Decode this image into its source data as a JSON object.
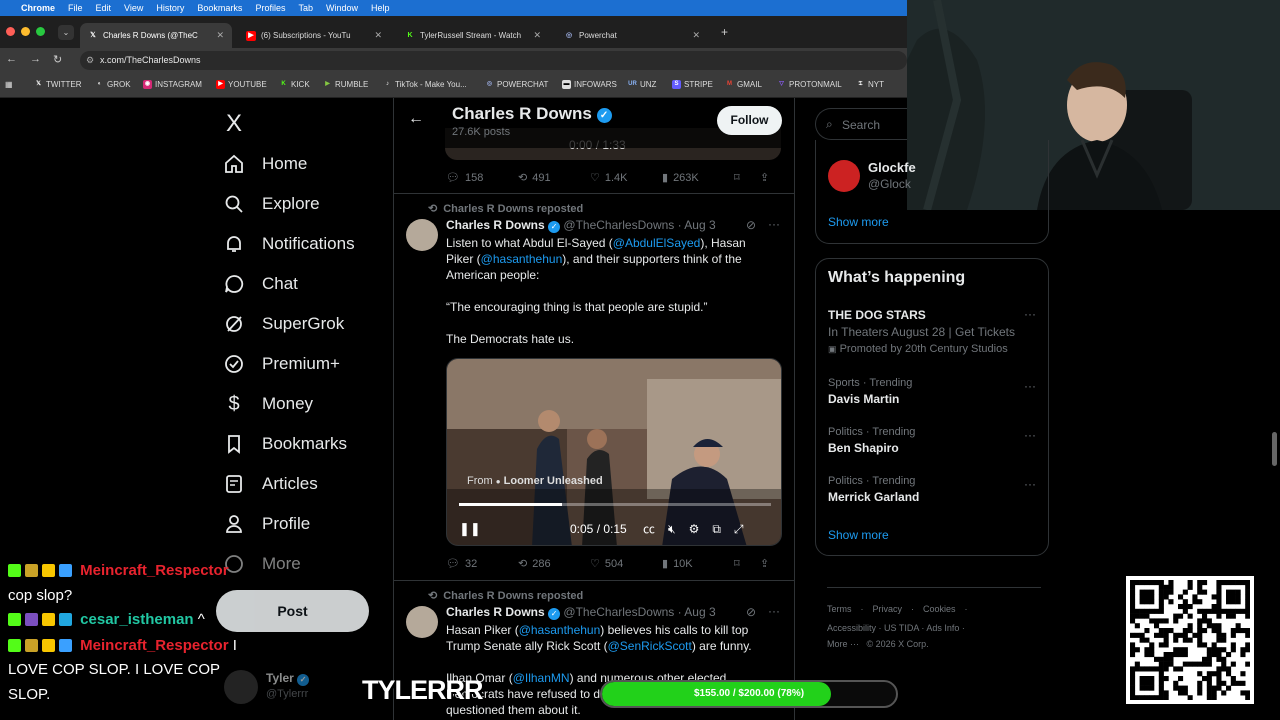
{
  "menubar": {
    "app": "Chrome",
    "items": [
      "File",
      "Edit",
      "View",
      "History",
      "Bookmarks",
      "Profiles",
      "Tab",
      "Window",
      "Help"
    ]
  },
  "tabs": [
    {
      "title": "Charles R Downs (@TheC",
      "active": true
    },
    {
      "title": "(6) Subscriptions - YouTu",
      "active": false
    },
    {
      "title": "TylerRussell Stream - Watch",
      "active": false
    },
    {
      "title": "Powerchat",
      "active": false
    }
  ],
  "url": "x.com/TheCharlesDowns",
  "bookmarks": [
    "TWITTER",
    "GROK",
    "INSTAGRAM",
    "YOUTUBE",
    "KICK",
    "RUMBLE",
    "TikTok - Make You...",
    "POWERCHAT",
    "INFOWARS",
    "UNZ",
    "STRIPE",
    "GMAIL",
    "PROTONMAIL",
    "NYT"
  ],
  "nav": {
    "logo": "X",
    "items": [
      "Home",
      "Explore",
      "Notifications",
      "Chat",
      "SuperGrok",
      "Premium+",
      "Money",
      "Bookmarks",
      "Articles",
      "Profile",
      "More"
    ],
    "post_button": "Post",
    "account_name": "Tyler",
    "account_handle": "@Tylerrr"
  },
  "profile_header": {
    "name": "Charles R Downs",
    "posts": "27.6K posts",
    "follow": "Follow"
  },
  "prev_video_time": "0:00 / 1:33",
  "prev_actions": {
    "replies": "158",
    "reposts": "491",
    "likes": "1.4K",
    "views": "263K"
  },
  "tweet1": {
    "repost_label": "Charles R Downs reposted",
    "name": "Charles R Downs",
    "handle": "@TheCharlesDowns · Aug 3",
    "t1": "Listen to what Abdul El-Sayed (",
    "l1": "@AbdulElSayed",
    "t2": "), Hasan",
    "t3": "Piker (",
    "l2": "@hasanthehun",
    "t4": "), and their supporters think of the",
    "t5": "American people:",
    "quote": "“The encouraging thing is that people are stupid.”",
    "closing": "The Democrats hate us.",
    "video": {
      "from": "From",
      "source": "Loomer Unleashed",
      "time": "0:05 / 0:15",
      "progress": 0.33
    },
    "actions": {
      "replies": "32",
      "reposts": "286",
      "likes": "504",
      "views": "10K"
    }
  },
  "tweet2": {
    "repost_label": "Charles R Downs reposted",
    "name": "Charles R Downs",
    "handle": "@TheCharlesDowns · Aug 3",
    "t1": "Hasan Piker (",
    "l1": "@hasanthehun",
    "t2": ") believes his calls to kill top",
    "t3": "Trump Senate ally Rick Scott (",
    "l2": "@SenRickScott",
    "t4": ") are funny.",
    "t5": "Ilhan Omar (",
    "l3": "@IlhanMN",
    "t6": ") and numerous other elected",
    "t7": "Democrats have refused to d",
    "t8": "questioned them about it."
  },
  "right": {
    "search_placeholder": "Search",
    "who_name": "Glockfe",
    "who_handle": "@Glock",
    "show_more_1": "Show more",
    "happening_title": "What’s happening",
    "promo": {
      "name": "THE DOG STARS",
      "line": "In Theaters August 28 | Get Tickets",
      "promoted": "Promoted by 20th Century Studios"
    },
    "trends": [
      {
        "cat": "Sports · Trending",
        "name": "Davis Martin"
      },
      {
        "cat": "Politics · Trending",
        "name": "Ben Shapiro"
      },
      {
        "cat": "Politics · Trending",
        "name": "Merrick Garland"
      }
    ],
    "show_more_2": "Show more",
    "footer": {
      "l1": [
        "Terms",
        "Privacy",
        "Cookies"
      ],
      "l2": [
        "Accessibility",
        "US TIDA",
        "Ads Info"
      ],
      "more": "More ···",
      "copyright": "© 2026 X Corp."
    }
  },
  "chat": [
    {
      "user": "Meincraft_Respector",
      "msg": "cop slop?",
      "color": "#e8232e"
    },
    {
      "user": "cesar_istheman",
      "msg": "^",
      "color": "#21c7a3"
    },
    {
      "user": "Meincraft_Respector",
      "msg": "I",
      "color": "#e8232e"
    }
  ],
  "chat_msg_3b": "LOVE COP SLOP. I LOVE COP",
  "chat_msg_3c": "SLOP.",
  "stream": {
    "brand": "TYLERRR",
    "goal": "$155.00 / $200.00 (78%)",
    "goal_fraction": 0.78
  },
  "colors": {
    "accent": "#1d9bf0",
    "follow_bg": "#eff3f4",
    "goal": "#22d11a"
  }
}
